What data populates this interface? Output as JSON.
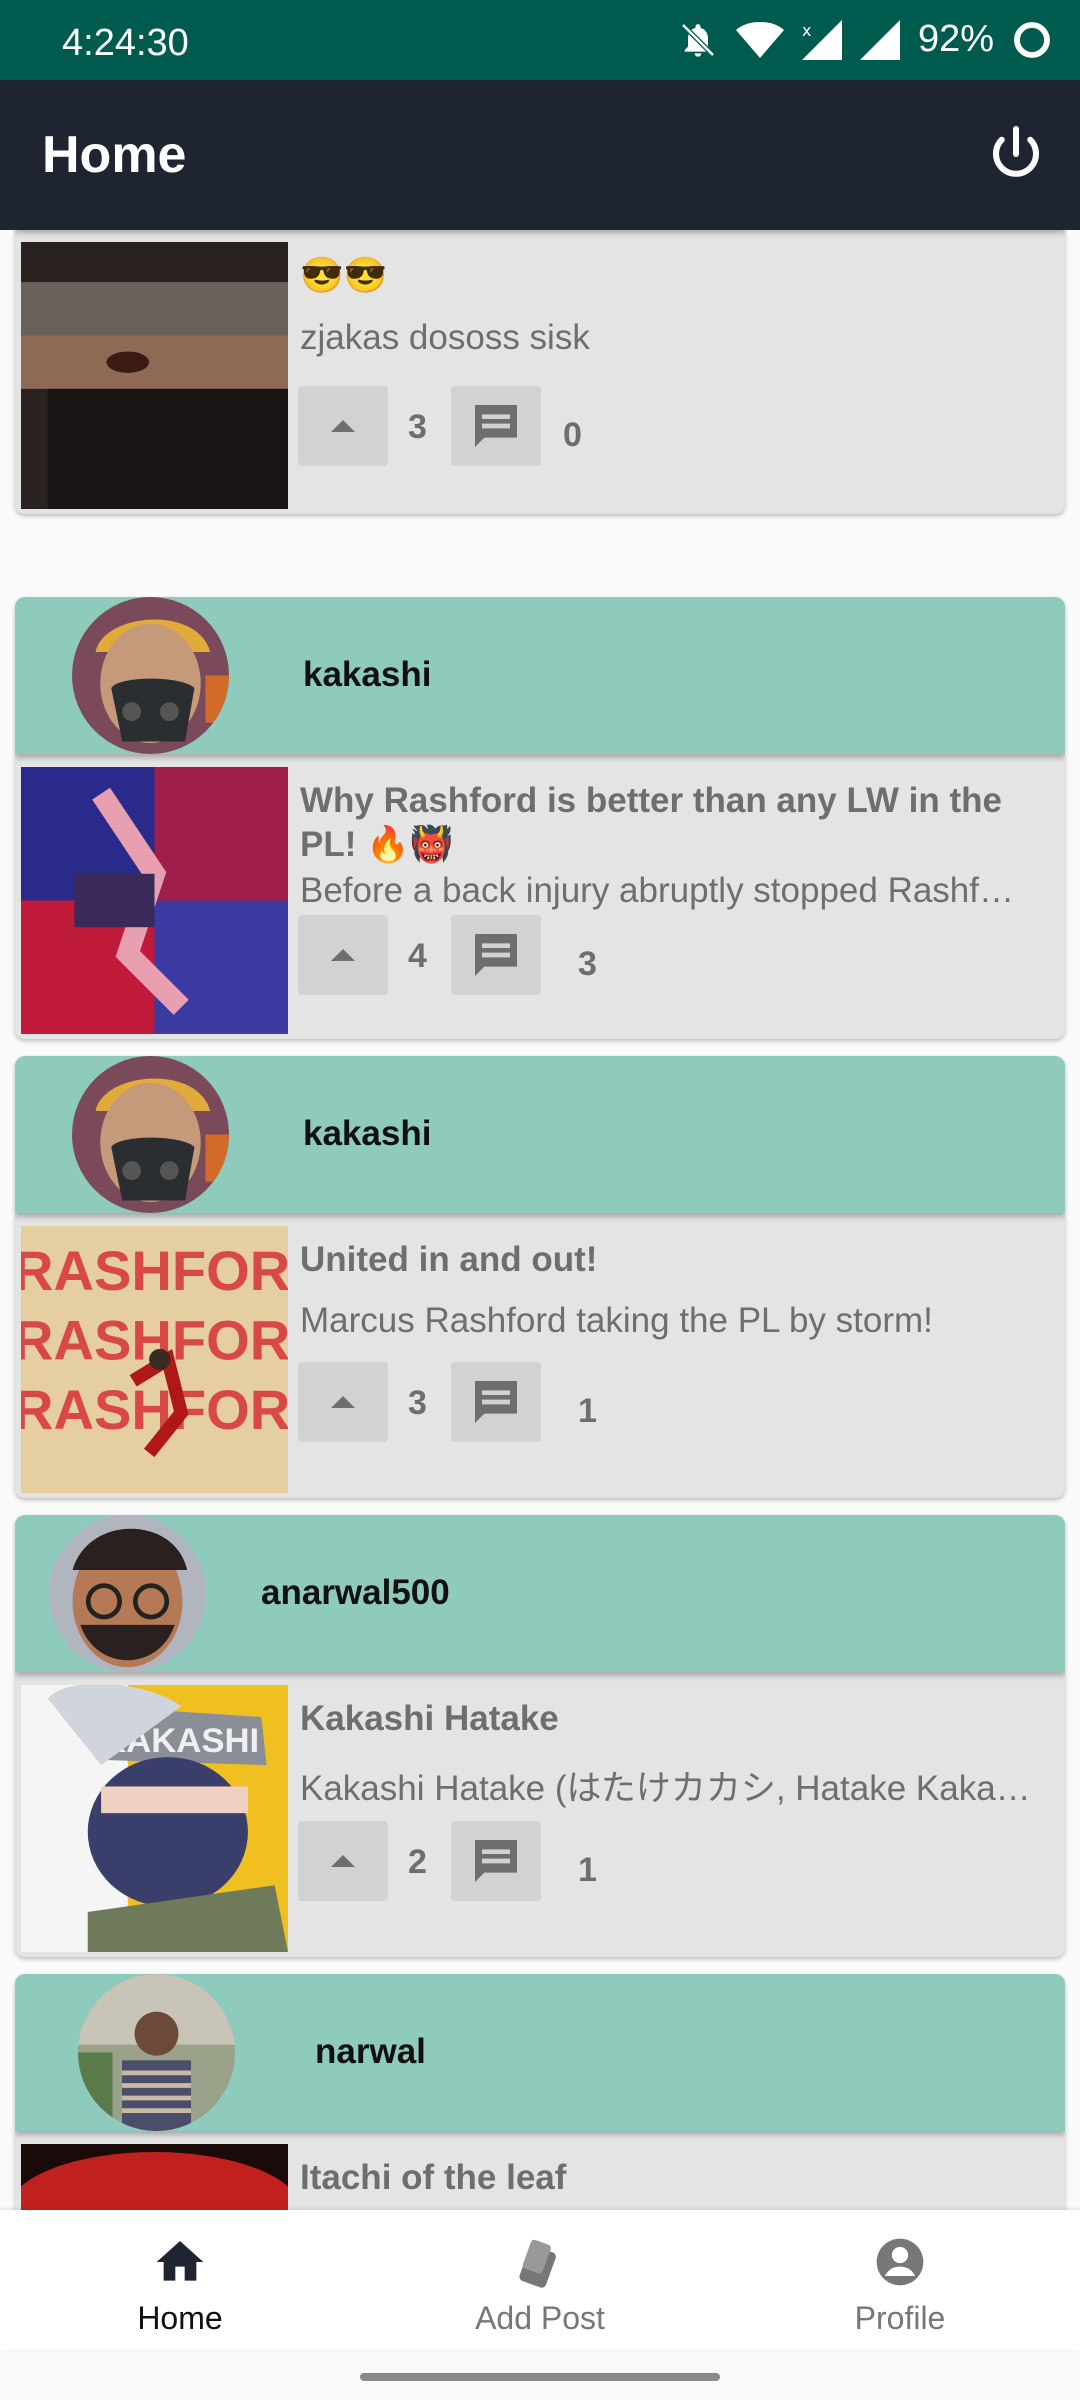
{
  "status": {
    "time": "4:24:30",
    "battery": "92%",
    "icons": [
      "bell-off-icon",
      "wifi-icon",
      "signal-x-icon",
      "signal-icon",
      "battery-ring-icon"
    ]
  },
  "appbar": {
    "title": "Home",
    "action_icon": "power-icon"
  },
  "posts": [
    {
      "username": "",
      "title": "😎😎",
      "body": "zjakas dososs sisk",
      "votes": "3",
      "comments": "0"
    },
    {
      "username": "kakashi",
      "title": "Why Rashford is better than any LW in the PL! 🔥👹",
      "body": "Before a back injury abruptly stopped Rashf…",
      "votes": "4",
      "comments": "3"
    },
    {
      "username": "kakashi",
      "title": "United in and out!",
      "body": "Marcus Rashford taking the PL by storm!",
      "votes": "3",
      "comments": "1"
    },
    {
      "username": "anarwal500",
      "title": "Kakashi Hatake",
      "body": "Kakashi Hatake (はたけカカシ, Hatake Kaka…",
      "votes": "2",
      "comments": "1"
    },
    {
      "username": "narwal",
      "title": "Itachi of the leaf",
      "body": "",
      "votes": "",
      "comments": ""
    }
  ],
  "thumb_texts": {
    "rashford": "RASHFORD",
    "kakashi": "KAKASHI"
  },
  "nav": {
    "items": [
      {
        "label": "Home",
        "icon": "home-icon"
      },
      {
        "label": "Add Post",
        "icon": "add-post-icon"
      },
      {
        "label": "Profile",
        "icon": "profile-icon"
      }
    ]
  },
  "colors": {
    "status_bar": "#005b4f",
    "app_bar": "#1f2530",
    "card_header": "#8ecbbd",
    "card_bg": "#e4e4e4"
  }
}
